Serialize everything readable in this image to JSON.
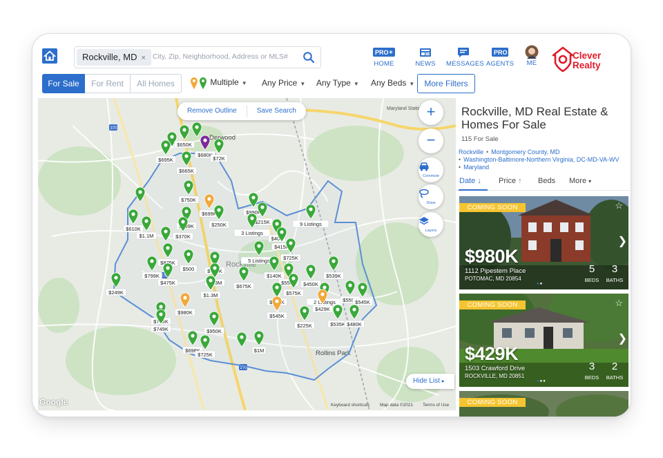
{
  "header": {
    "search_chip": "Rockville, MD",
    "search_chip_close": "×",
    "search_placeholder": "City, Zip, Neighborhood, Address or MLS#",
    "nav": [
      {
        "label": "HOME",
        "badge": "PRO"
      },
      {
        "label": "NEWS"
      },
      {
        "label": "MESSAGES"
      },
      {
        "label": "AGENTS",
        "badge": "PRO"
      },
      {
        "label": "ME"
      }
    ],
    "brand_line1": "Clever",
    "brand_line2": "Realty",
    "brand_color": "#e01b2b"
  },
  "filters": {
    "segments": [
      "For Sale",
      "For Rent",
      "All Homes"
    ],
    "active_segment": "For Sale",
    "property_type": "Multiple",
    "price": "Any Price",
    "type": "Any Type",
    "beds": "Any Beds",
    "more": "More Filters"
  },
  "map": {
    "remove_outline": "Remove Outline",
    "save_search": "Save Search",
    "zoom_in": "+",
    "zoom_out": "−",
    "commute": "Commute",
    "draw": "Draw",
    "layers": "Layers",
    "hide_list": "Hide List",
    "hide_list_arrow": "▸",
    "keyboard": "Keyboard shortcuts",
    "map_data": "Map data ©2021",
    "terms": "Terms of Use",
    "google": "Google",
    "places": [
      "Derwood",
      "Rockville",
      "Rollins Park",
      "Maryland Station"
    ],
    "price_labels": [
      "$650K",
      "$695K",
      "$665K",
      "$680K",
      "$72K",
      "$750K",
      "$699K",
      "$250K",
      "$399K",
      "$370K",
      "$610K",
      "$1.1M",
      "$990K",
      "$215K",
      "9 Listings",
      "$400",
      "3 Listings",
      "$415K",
      "$725K",
      "5 Listings",
      "$140K",
      "$875K",
      "$500",
      "$725K",
      "$1.3M",
      "$799K",
      "$475K",
      "$1.3M",
      "$675K",
      "$550K",
      "$575K",
      "$450K",
      "$539K",
      "$600K",
      "$545K",
      "2 Listings",
      "$429K",
      "$559K",
      "$545K",
      "$249K",
      "$980K",
      "$785K",
      "$749K",
      "$950K",
      "$698K",
      "$725K",
      "$1M",
      "$225K",
      "$535K",
      "$480K"
    ],
    "pin_colors": {
      "green": "#3aa83a",
      "orange": "#f0a93b",
      "purple": "#7d2a98"
    },
    "outline_color": "#5b8fd6"
  },
  "panel": {
    "title": "Rockville, MD Real Estate & Homes For Sale",
    "count": "115 For Sale",
    "links": [
      "Rockville",
      "Montgomery County, MD",
      "Washington-Baltimore-Northern Virginia, DC-MD-VA-WV",
      "Maryland"
    ],
    "tabs": [
      {
        "label": "Date",
        "suffix": "↓"
      },
      {
        "label": "Price",
        "suffix": "↑"
      },
      {
        "label": "Beds",
        "suffix": ""
      },
      {
        "label": "More",
        "suffix": "▾"
      }
    ],
    "listings": [
      {
        "badge": "COMING SOON",
        "price": "$980K",
        "address": "1112 Pipestem Place",
        "city": "POTOMAC, MD 20854",
        "beds": "5",
        "baths": "3",
        "beds_label": "BEDS",
        "baths_label": "BATHS"
      },
      {
        "badge": "COMING SOON",
        "price": "$429K",
        "address": "1503 Crawford Drive",
        "city": "ROCKVILLE, MD 20851",
        "beds": "3",
        "baths": "2",
        "beds_label": "BEDS",
        "baths_label": "BATHS"
      },
      {
        "badge": "COMING SOON"
      }
    ]
  }
}
